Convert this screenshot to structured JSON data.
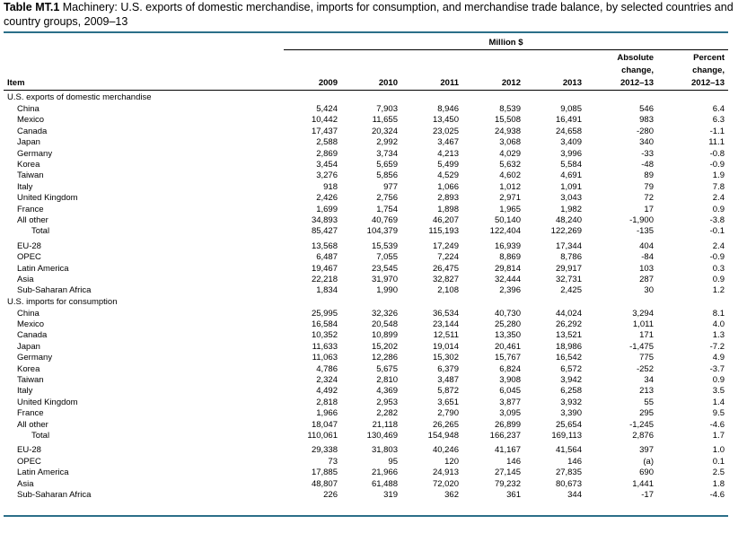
{
  "title": {
    "label": "Table MT.1",
    "text_line1": "Machinery: U.S. exports of domestic merchandise, imports for consumption, and merchandise trade balance, by selected countries and",
    "text_line2": "country groups, 2009–13"
  },
  "header": {
    "unit": "Million $",
    "item": "Item",
    "years": [
      "2009",
      "2010",
      "2011",
      "2012",
      "2013"
    ],
    "abs_change": [
      "Absolute",
      "change,",
      "2012–13"
    ],
    "pct_change": [
      "Percent",
      "change,",
      "2012–13"
    ]
  },
  "sections": [
    {
      "title": "U.S. exports of domestic merchandise",
      "groups": [
        [
          {
            "label": "China",
            "values": [
              "5,424",
              "7,903",
              "8,946",
              "8,539",
              "9,085",
              "546",
              "6.4"
            ]
          },
          {
            "label": "Mexico",
            "values": [
              "10,442",
              "11,655",
              "13,450",
              "15,508",
              "16,491",
              "983",
              "6.3"
            ]
          },
          {
            "label": "Canada",
            "values": [
              "17,437",
              "20,324",
              "23,025",
              "24,938",
              "24,658",
              "-280",
              "-1.1"
            ]
          },
          {
            "label": "Japan",
            "values": [
              "2,588",
              "2,992",
              "3,467",
              "3,068",
              "3,409",
              "340",
              "11.1"
            ]
          },
          {
            "label": "Germany",
            "values": [
              "2,869",
              "3,734",
              "4,213",
              "4,029",
              "3,996",
              "-33",
              "-0.8"
            ]
          },
          {
            "label": "Korea",
            "values": [
              "3,454",
              "5,659",
              "5,499",
              "5,632",
              "5,584",
              "-48",
              "-0.9"
            ]
          },
          {
            "label": "Taiwan",
            "values": [
              "3,276",
              "5,856",
              "4,529",
              "4,602",
              "4,691",
              "89",
              "1.9"
            ]
          },
          {
            "label": "Italy",
            "values": [
              "918",
              "977",
              "1,066",
              "1,012",
              "1,091",
              "79",
              "7.8"
            ]
          },
          {
            "label": "United Kingdom",
            "values": [
              "2,426",
              "2,756",
              "2,893",
              "2,971",
              "3,043",
              "72",
              "2.4"
            ]
          },
          {
            "label": "France",
            "values": [
              "1,699",
              "1,754",
              "1,898",
              "1,965",
              "1,982",
              "17",
              "0.9"
            ]
          },
          {
            "label": "All other",
            "values": [
              "34,893",
              "40,769",
              "46,207",
              "50,140",
              "48,240",
              "-1,900",
              "-3.8"
            ]
          },
          {
            "label": "Total",
            "total": true,
            "values": [
              "85,427",
              "104,379",
              "115,193",
              "122,404",
              "122,269",
              "-135",
              "-0.1"
            ]
          }
        ],
        [
          {
            "label": "EU-28",
            "values": [
              "13,568",
              "15,539",
              "17,249",
              "16,939",
              "17,344",
              "404",
              "2.4"
            ]
          },
          {
            "label": "OPEC",
            "values": [
              "6,487",
              "7,055",
              "7,224",
              "8,869",
              "8,786",
              "-84",
              "-0.9"
            ]
          },
          {
            "label": "Latin America",
            "values": [
              "19,467",
              "23,545",
              "26,475",
              "29,814",
              "29,917",
              "103",
              "0.3"
            ]
          },
          {
            "label": "Asia",
            "values": [
              "22,218",
              "31,970",
              "32,827",
              "32,444",
              "32,731",
              "287",
              "0.9"
            ]
          },
          {
            "label": "Sub-Saharan Africa",
            "values": [
              "1,834",
              "1,990",
              "2,108",
              "2,396",
              "2,425",
              "30",
              "1.2"
            ]
          }
        ]
      ]
    },
    {
      "title": "U.S. imports for consumption",
      "groups": [
        [
          {
            "label": "China",
            "values": [
              "25,995",
              "32,326",
              "36,534",
              "40,730",
              "44,024",
              "3,294",
              "8.1"
            ]
          },
          {
            "label": "Mexico",
            "values": [
              "16,584",
              "20,548",
              "23,144",
              "25,280",
              "26,292",
              "1,011",
              "4.0"
            ]
          },
          {
            "label": "Canada",
            "values": [
              "10,352",
              "10,899",
              "12,511",
              "13,350",
              "13,521",
              "171",
              "1.3"
            ]
          },
          {
            "label": "Japan",
            "values": [
              "11,633",
              "15,202",
              "19,014",
              "20,461",
              "18,986",
              "-1,475",
              "-7.2"
            ]
          },
          {
            "label": "Germany",
            "values": [
              "11,063",
              "12,286",
              "15,302",
              "15,767",
              "16,542",
              "775",
              "4.9"
            ]
          },
          {
            "label": "Korea",
            "values": [
              "4,786",
              "5,675",
              "6,379",
              "6,824",
              "6,572",
              "-252",
              "-3.7"
            ]
          },
          {
            "label": "Taiwan",
            "values": [
              "2,324",
              "2,810",
              "3,487",
              "3,908",
              "3,942",
              "34",
              "0.9"
            ]
          },
          {
            "label": "Italy",
            "values": [
              "4,492",
              "4,369",
              "5,872",
              "6,045",
              "6,258",
              "213",
              "3.5"
            ]
          },
          {
            "label": "United Kingdom",
            "values": [
              "2,818",
              "2,953",
              "3,651",
              "3,877",
              "3,932",
              "55",
              "1.4"
            ]
          },
          {
            "label": "France",
            "values": [
              "1,966",
              "2,282",
              "2,790",
              "3,095",
              "3,390",
              "295",
              "9.5"
            ]
          },
          {
            "label": "All other",
            "values": [
              "18,047",
              "21,118",
              "26,265",
              "26,899",
              "25,654",
              "-1,245",
              "-4.6"
            ]
          },
          {
            "label": "Total",
            "total": true,
            "values": [
              "110,061",
              "130,469",
              "154,948",
              "166,237",
              "169,113",
              "2,876",
              "1.7"
            ]
          }
        ],
        [
          {
            "label": "EU-28",
            "values": [
              "29,338",
              "31,803",
              "40,246",
              "41,167",
              "41,564",
              "397",
              "1.0"
            ]
          },
          {
            "label": "OPEC",
            "values": [
              "73",
              "95",
              "120",
              "146",
              "146",
              "(a)",
              "0.1"
            ]
          },
          {
            "label": "Latin America",
            "values": [
              "17,885",
              "21,966",
              "24,913",
              "27,145",
              "27,835",
              "690",
              "2.5"
            ]
          },
          {
            "label": "Asia",
            "values": [
              "48,807",
              "61,488",
              "72,020",
              "79,232",
              "80,673",
              "1,441",
              "1.8"
            ]
          },
          {
            "label": "Sub-Saharan Africa",
            "values": [
              "226",
              "319",
              "362",
              "361",
              "344",
              "-17",
              "-4.6"
            ]
          }
        ]
      ]
    }
  ]
}
